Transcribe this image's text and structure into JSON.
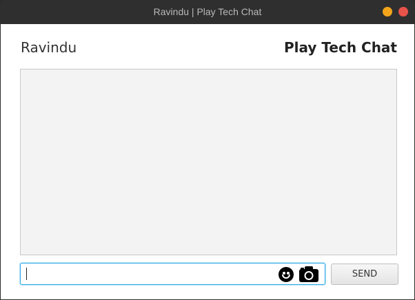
{
  "window": {
    "title": "Ravindu | Play Tech Chat",
    "minimize_color": "#f2a51a",
    "close_color": "#e8534a"
  },
  "header": {
    "user_name": "Ravindu",
    "app_name": "Play Tech Chat"
  },
  "chat": {
    "messages": []
  },
  "composer": {
    "input_value": "",
    "input_placeholder": "",
    "emoji_icon": "emoji-icon",
    "camera_icon": "camera-icon",
    "send_label": "SEND",
    "focus_color": "#2fa9e6"
  }
}
